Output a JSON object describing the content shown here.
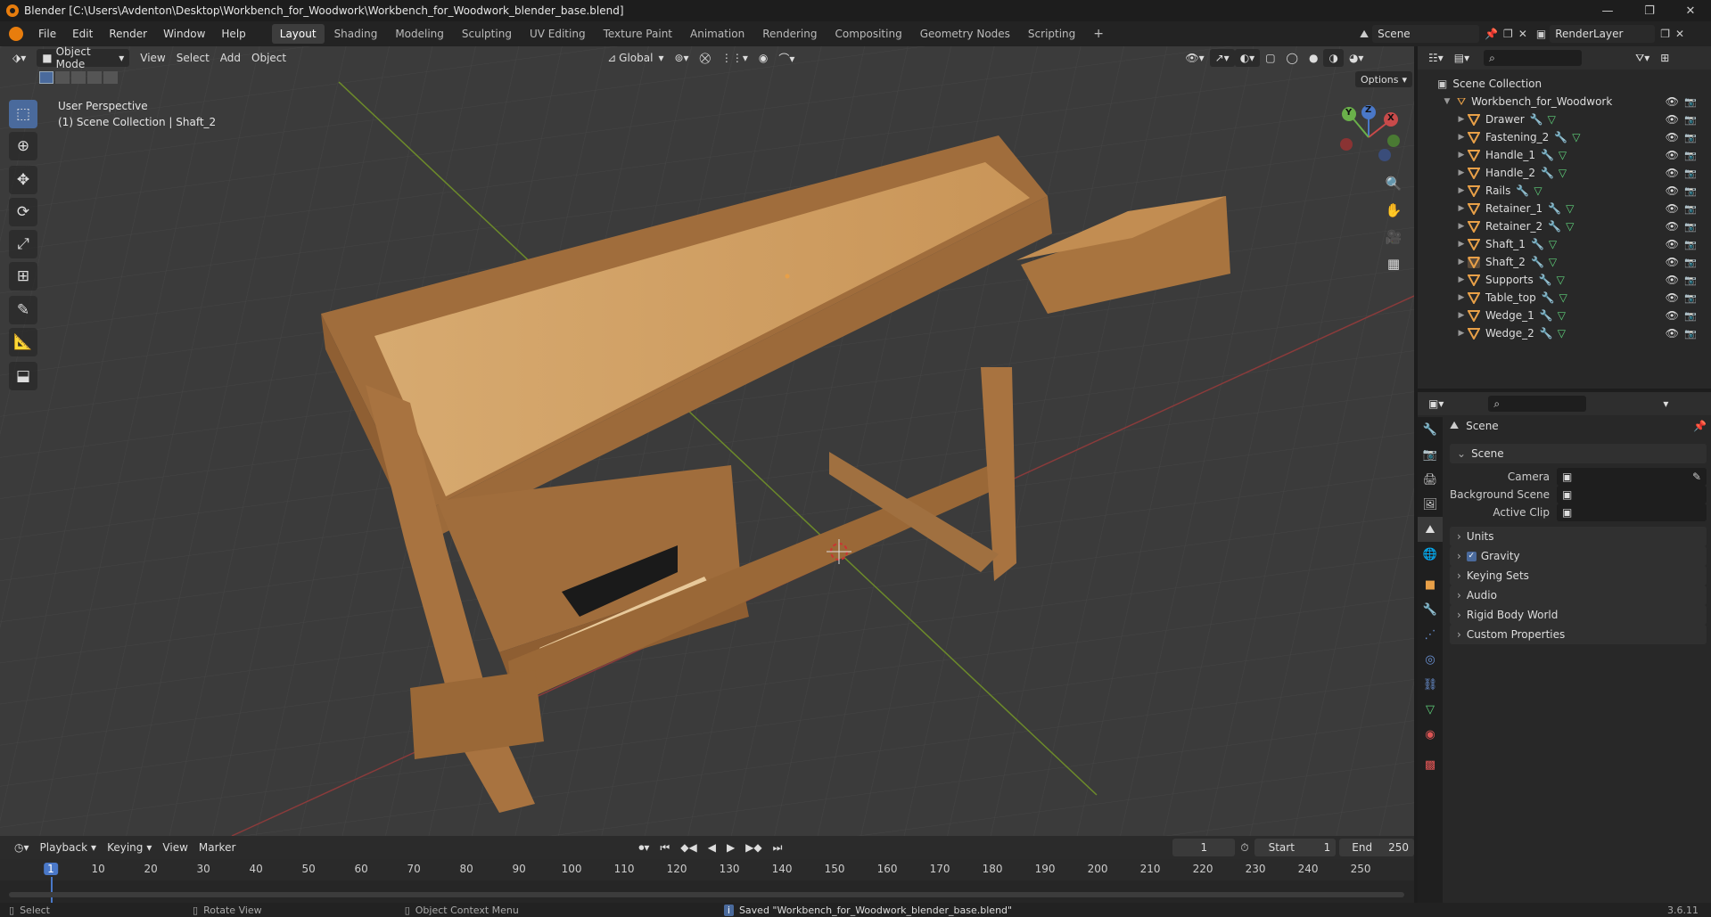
{
  "window": {
    "title": "Blender [C:\\Users\\Avdenton\\Desktop\\Workbench_for_Woodwork\\Workbench_for_Woodwork_blender_base.blend]",
    "minimize": "—",
    "maximize": "❐",
    "close": "✕"
  },
  "menus": [
    "File",
    "Edit",
    "Render",
    "Window",
    "Help"
  ],
  "workspaces": [
    "Layout",
    "Shading",
    "Modeling",
    "Sculpting",
    "UV Editing",
    "Texture Paint",
    "Animation",
    "Rendering",
    "Compositing",
    "Geometry Nodes",
    "Scripting"
  ],
  "active_workspace": "Layout",
  "add_workspace": "+",
  "scene_field": "Scene",
  "renderlayer_field": "RenderLayer",
  "viewport": {
    "mode": "Object Mode",
    "menus": [
      "View",
      "Select",
      "Add",
      "Object"
    ],
    "transform_orientation": "Global",
    "options_label": "Options",
    "overlay_line1": "User Perspective",
    "overlay_line2": "(1) Scene Collection | Shaft_2",
    "gizmo": {
      "x": "X",
      "y": "Y",
      "z": "Z"
    }
  },
  "outliner": {
    "root": "Scene Collection",
    "collection": "Workbench_for_Woodwork",
    "objects": [
      "Drawer",
      "Fastening_2",
      "Handle_1",
      "Handle_2",
      "Rails",
      "Retainer_1",
      "Retainer_2",
      "Shaft_1",
      "Shaft_2",
      "Supports",
      "Table_top",
      "Wedge_1",
      "Wedge_2"
    ],
    "selected": "Shaft_2"
  },
  "properties": {
    "context": "Scene",
    "panel": "Scene",
    "rows": [
      {
        "label": "Camera",
        "value": ""
      },
      {
        "label": "Background Scene",
        "value": ""
      },
      {
        "label": "Active Clip",
        "value": ""
      }
    ],
    "sections": [
      "Units",
      "Gravity",
      "Keying Sets",
      "Audio",
      "Rigid Body World",
      "Custom Properties"
    ],
    "gravity_checked": true
  },
  "timeline": {
    "menus": [
      "Playback",
      "Keying",
      "View",
      "Marker"
    ],
    "current_frame": "1",
    "start_label": "Start",
    "start": "1",
    "end_label": "End",
    "end": "250",
    "ticks": [
      "1",
      "10",
      "20",
      "30",
      "40",
      "50",
      "60",
      "70",
      "80",
      "90",
      "100",
      "110",
      "120",
      "130",
      "140",
      "150",
      "160",
      "170",
      "180",
      "190",
      "200",
      "210",
      "220",
      "230",
      "240",
      "250"
    ]
  },
  "status": {
    "select": "Select",
    "rotate": "Rotate View",
    "context_menu": "Object Context Menu",
    "message": "Saved \"Workbench_for_Woodwork_blender_base.blend\"",
    "version": "3.6.11"
  },
  "colors": {
    "accent": "#4a6a9c",
    "object_orange": "#e8a048",
    "wood": "#b07a45"
  }
}
